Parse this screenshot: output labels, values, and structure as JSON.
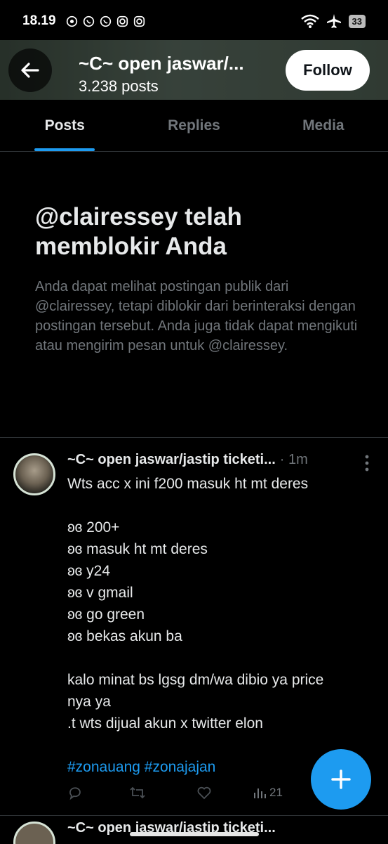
{
  "status_bar": {
    "time": "18.19",
    "battery": "33"
  },
  "header": {
    "title": "~C~ open jaswar/...",
    "posts_count": "3.238 posts",
    "follow_label": "Follow"
  },
  "tabs": [
    {
      "label": "Posts",
      "active": true
    },
    {
      "label": "Replies",
      "active": false
    },
    {
      "label": "Media",
      "active": false
    }
  ],
  "block_notice": {
    "title": "@clairessey telah memblokir Anda",
    "description": "Anda dapat melihat postingan publik dari @clairessey, tetapi diblokir dari berinteraksi dengan postingan tersebut. Anda juga tidak dapat mengikuti atau mengirim pesan untuk @clairessey."
  },
  "post": {
    "author": "~C~ open jaswar/jastip ticketi...",
    "time": "· 1m",
    "lines": [
      "Wts acc x ini f200 masuk ht mt deres",
      "",
      "ʚɞ 200+",
      "ʚɞ masuk ht mt deres",
      "ʚɞ y24",
      "ʚɞ v gmail",
      "ʚɞ go green",
      "ʚɞ bekas akun ba",
      "",
      "kalo minat bs lgsg dm/wa dibio ya price",
      "nya ya",
      ".t wts dijual akun x twitter elon",
      ""
    ],
    "hashtags": "#zonauang #zonajajan",
    "views": "21"
  },
  "next_post": {
    "author": "~C~ open jaswar/jastip ticketi..."
  },
  "colors": {
    "accent": "#1d9bf0",
    "background": "#000000",
    "secondary_text": "#71767b"
  }
}
